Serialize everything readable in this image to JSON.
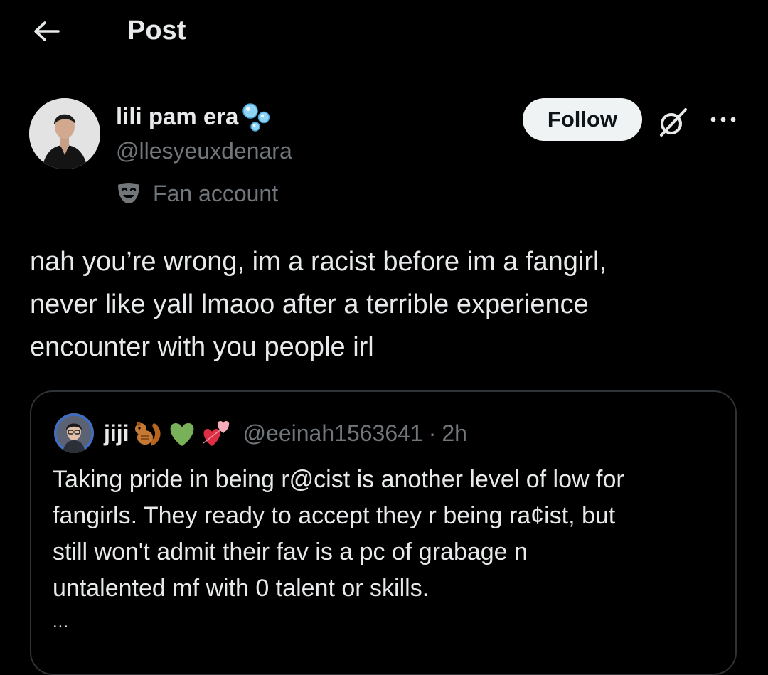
{
  "header": {
    "title": "Post",
    "back_icon": "arrow-left-icon"
  },
  "author": {
    "display_name": "lili pam era",
    "name_emoji": "bubbles-icon",
    "handle": "@llesyeuxdenara",
    "badge_icon": "theater-masks-icon",
    "badge_label": "Fan account",
    "follow_label": "Follow"
  },
  "actions": {
    "grok_icon": "grok-icon",
    "more_icon": "more-dots-icon"
  },
  "post": {
    "text": "nah you’re wrong, im a racist before im a fangirl,\nnever like yall lmaoo after a terrible experience\nencounter with you people irl"
  },
  "quoted_post": {
    "display_name": "jiji",
    "name_emojis": [
      "chipmunk-icon",
      "green-heart-icon",
      "two-hearts-icon"
    ],
    "handle": "@eeinah1563641",
    "separator": "·",
    "time": "2h",
    "text": "Taking pride in being r@cist is another level of low for\nfangirls. They ready to accept they r being ra¢ist, but\nstill won't admit their fav is a pc of grabage n\nuntalented mf with 0 talent or skills.",
    "truncation": "..."
  },
  "colors": {
    "background": "#000000",
    "primary_text": "#e7e9ea",
    "secondary_text": "#71767b",
    "border": "#2f3336",
    "follow_bg": "#eff3f4"
  }
}
